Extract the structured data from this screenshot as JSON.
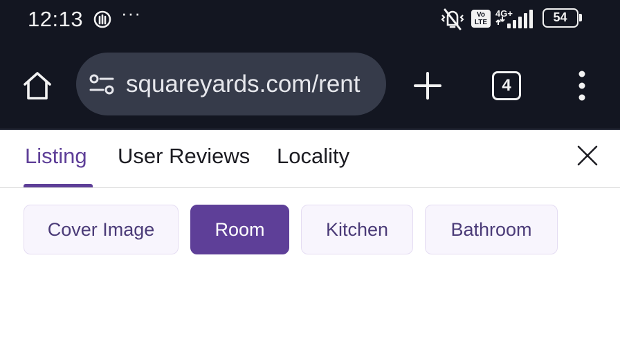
{
  "status_bar": {
    "time": "12:13",
    "more": "···",
    "volte": "Vo LTE",
    "network": "4G+",
    "battery": "54"
  },
  "browser": {
    "url": "squareyards.com/rent",
    "tab_count": "4",
    "icons": [
      "home-icon",
      "tune-icon",
      "plus-icon",
      "more-vert-icon"
    ]
  },
  "page_tabs": {
    "items": [
      "Listing",
      "User Reviews",
      "Locality"
    ],
    "active": "Listing"
  },
  "chips": {
    "items": [
      "Cover Image",
      "Room",
      "Kitchen",
      "Bathroom"
    ],
    "selected": "Room"
  },
  "colors": {
    "chrome_bg": "#131621",
    "url_bar_bg": "#363b4a",
    "accent": "#5e3f98",
    "chip_bg": "#f8f5fd"
  }
}
